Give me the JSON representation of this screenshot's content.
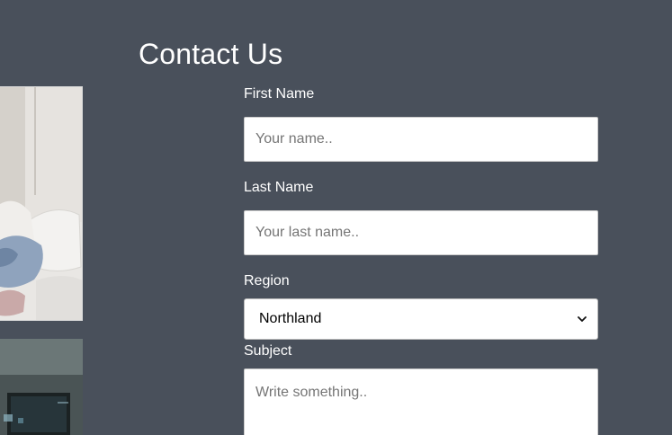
{
  "page": {
    "title": "Contact Us"
  },
  "form": {
    "first_name": {
      "label": "First Name",
      "placeholder": "Your name..",
      "value": ""
    },
    "last_name": {
      "label": "Last Name",
      "placeholder": "Your last name..",
      "value": ""
    },
    "region": {
      "label": "Region",
      "selected": "Northland",
      "icon": "chevron-down-icon"
    },
    "subject": {
      "label": "Subject",
      "placeholder": "Write something..",
      "value": ""
    }
  },
  "colors": {
    "background": "#49505b",
    "text": "#ffffff",
    "field_background": "#ffffff"
  }
}
